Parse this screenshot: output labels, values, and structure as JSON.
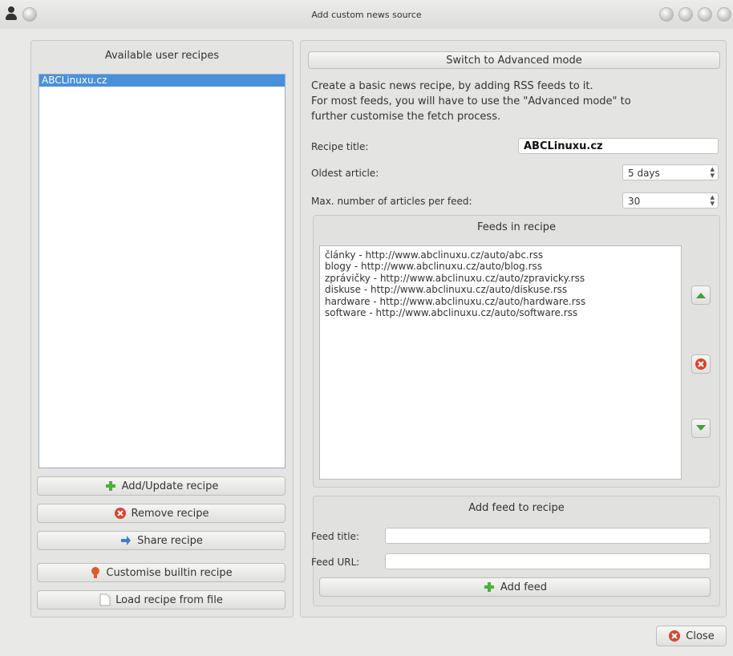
{
  "window": {
    "title": "Add custom news source"
  },
  "left": {
    "header": "Available user recipes",
    "recipes": [
      "ABCLinuxu.cz"
    ],
    "buttons": {
      "add_update": "Add/Update recipe",
      "remove": "Remove recipe",
      "share": "Share recipe",
      "customise": "Customise builtin recipe",
      "load": "Load recipe from file"
    }
  },
  "right": {
    "advanced_button": "Switch to Advanced mode",
    "description": [
      "Create a basic news recipe, by adding RSS feeds to it.",
      "For most feeds, you will have to use the \"Advanced mode\" to",
      "further customise the fetch process."
    ],
    "recipe_title_label": "Recipe title:",
    "recipe_title_value": "ABCLinuxu.cz",
    "oldest_label": "Oldest article:",
    "oldest_value": "5 days",
    "max_label": "Max. number of articles per feed:",
    "max_value": "30",
    "feeds_header": "Feeds in recipe",
    "feeds": [
      "články - http://www.abclinuxu.cz/auto/abc.rss",
      "blogy - http://www.abclinuxu.cz/auto/blog.rss",
      "zprávičky - http://www.abclinuxu.cz/auto/zpravicky.rss",
      "diskuse - http://www.abclinuxu.cz/auto/diskuse.rss",
      "hardware - http://www.abclinuxu.cz/auto/hardware.rss",
      "software - http://www.abclinuxu.cz/auto/software.rss"
    ],
    "add_feed_header": "Add feed to recipe",
    "feed_title_label": "Feed title:",
    "feed_title_value": "",
    "feed_url_label": "Feed URL:",
    "feed_url_value": "",
    "add_feed_button": "Add feed"
  },
  "close_button": "Close",
  "colors": {
    "selection": "#4a90d9",
    "green": "#4caf3a",
    "red": "#d9442c",
    "blue": "#3b7fd0"
  }
}
